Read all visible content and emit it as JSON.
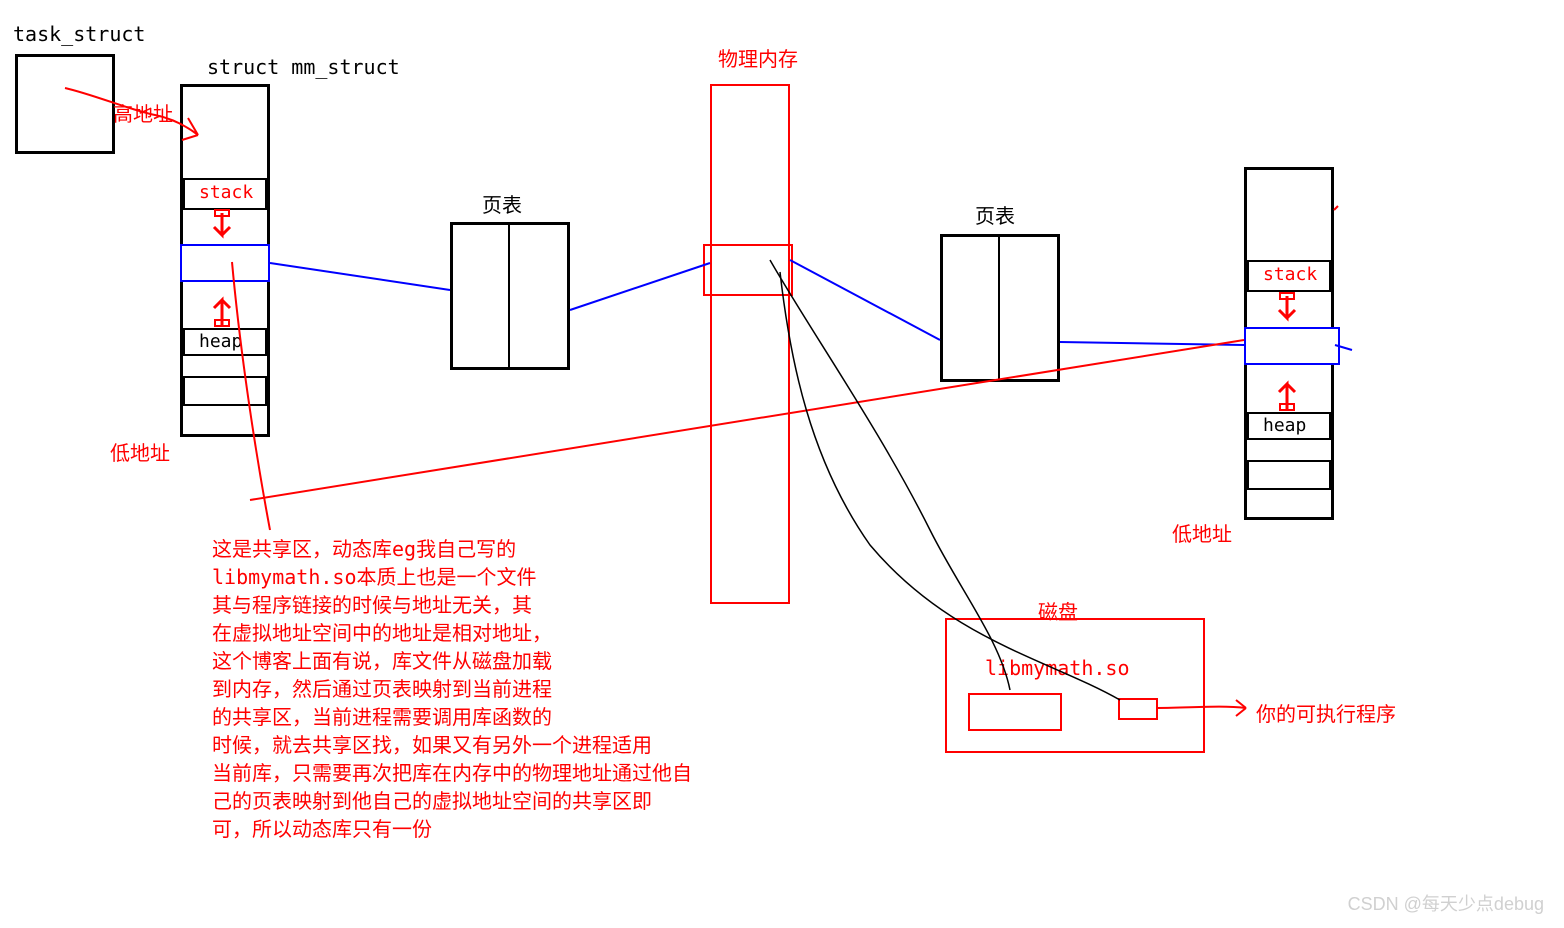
{
  "labels": {
    "task_struct": "task_struct",
    "mm_struct": "struct mm_struct",
    "high_addr": "高地址",
    "low_addr_left": "低地址",
    "low_addr_right": "低地址",
    "stack_left": "stack",
    "heap_left": "heap",
    "stack_right": "stack",
    "heap_right": "heap",
    "page_table_left": "页表",
    "page_table_right": "页表",
    "phys_mem": "物理内存",
    "disk": "磁盘",
    "libname": "libmymath.so",
    "exe_note": "你的可执行程序",
    "watermark": "CSDN @每天少点debug"
  },
  "paragraph": "这是共享区，动态库eg我自己写的\nlibmymath.so本质上也是一个文件\n其与程序链接的时候与地址无关，其\n在虚拟地址空间中的地址是相对地址，\n这个博客上面有说，库文件从磁盘加载\n到内存，然后通过页表映射到当前进程\n的共享区，当前进程需要调用库函数的\n时候，就去共享区找，如果又有另外一个进程适用\n当前库，只需要再次把库在内存中的物理地址通过他自\n己的页表映射到他自己的虚拟地址空间的共享区即\n可，所以动态库只有一份"
}
